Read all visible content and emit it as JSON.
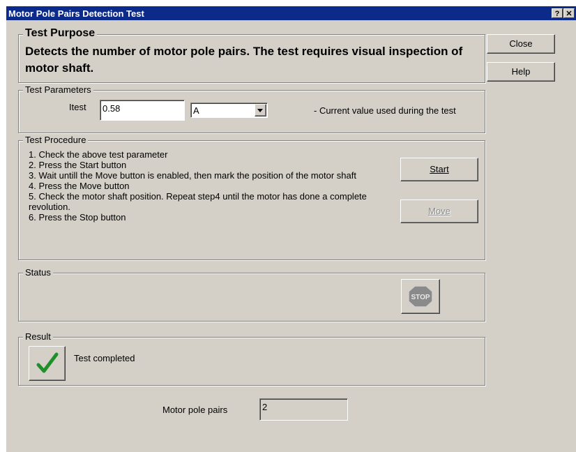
{
  "window": {
    "title": "Motor Pole Pairs Detection Test",
    "help_glyph": "?",
    "close_glyph": "✕"
  },
  "purpose": {
    "legend": "Test Purpose",
    "text": "Detects the number of motor pole pairs. The test requires visual inspection of motor shaft."
  },
  "buttons": {
    "close": "Close",
    "help": "Help"
  },
  "parameters": {
    "legend": "Test Parameters",
    "itest_label": "Itest",
    "itest_value": "0.58",
    "unit_value": "A",
    "description": "- Current value used during the test"
  },
  "procedure": {
    "legend": "Test Procedure",
    "steps": [
      "1. Check the above test parameter",
      "2. Press the Start button",
      "3. Wait untill the Move button is enabled, then mark the position of the motor shaft",
      "4. Press the Move button",
      "5. Check the motor shaft position. Repeat step4 until the motor has done a complete revolution.",
      "6. Press the Stop button"
    ],
    "start_button": "Start",
    "move_button": "Move"
  },
  "status": {
    "legend": "Status",
    "stop_sign_text": "STOP"
  },
  "result": {
    "legend": "Result",
    "message": "Test completed"
  },
  "pole_pairs": {
    "label": "Motor pole pairs",
    "value": "2"
  },
  "colors": {
    "titlebar": "#0b2a8a",
    "dialog_bg": "#d4d0c8",
    "check_green": "#1f8f2a",
    "stop_gray": "#8a8a8a"
  }
}
